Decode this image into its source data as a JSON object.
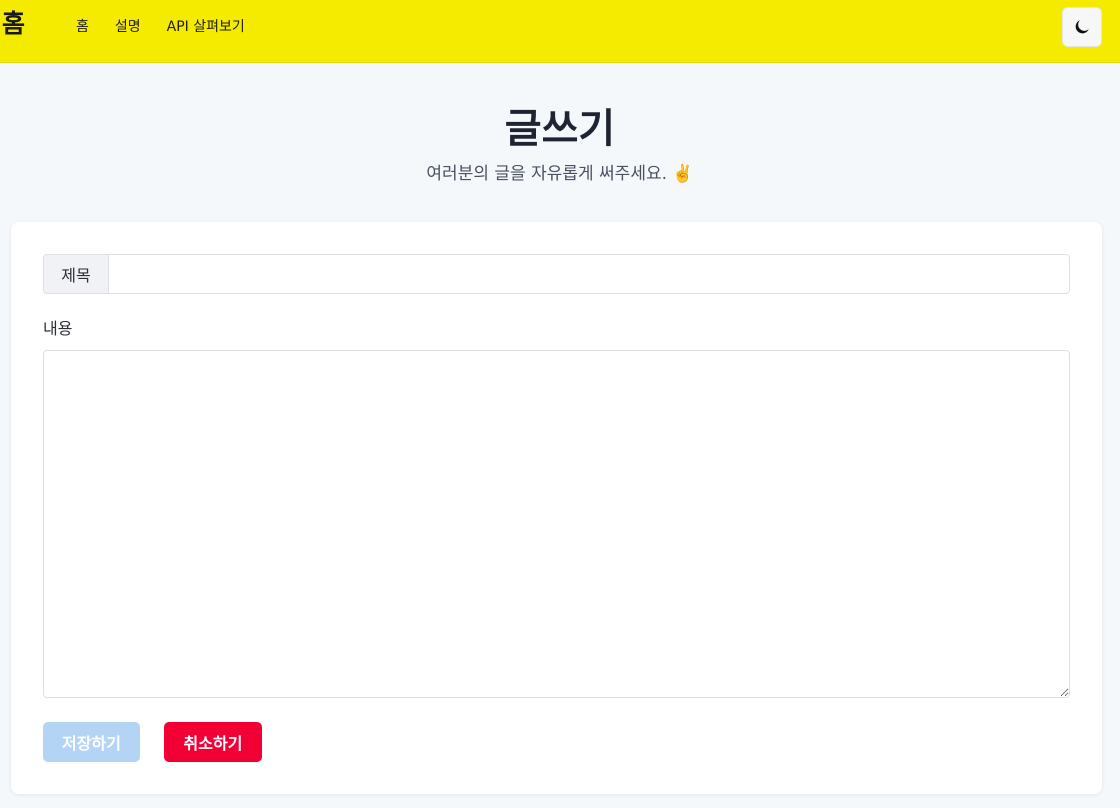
{
  "navbar": {
    "brand": "홈",
    "links": [
      {
        "label": "홈"
      },
      {
        "label": "설명"
      },
      {
        "label": "API 살펴보기"
      }
    ],
    "theme_toggle_icon": "moon-icon"
  },
  "header": {
    "title": "글쓰기",
    "subtitle": "여러분의 글을 자유롭게 써주세요. ✌️"
  },
  "form": {
    "title_label": "제목",
    "title_value": "",
    "content_label": "내용",
    "content_value": "",
    "save_label": "저장하기",
    "cancel_label": "취소하기"
  },
  "colors": {
    "navbar_bg": "#f5eb00",
    "save_button": "#b3d4f5",
    "cancel_button": "#f20035",
    "page_bg": "#f5f8fb"
  }
}
